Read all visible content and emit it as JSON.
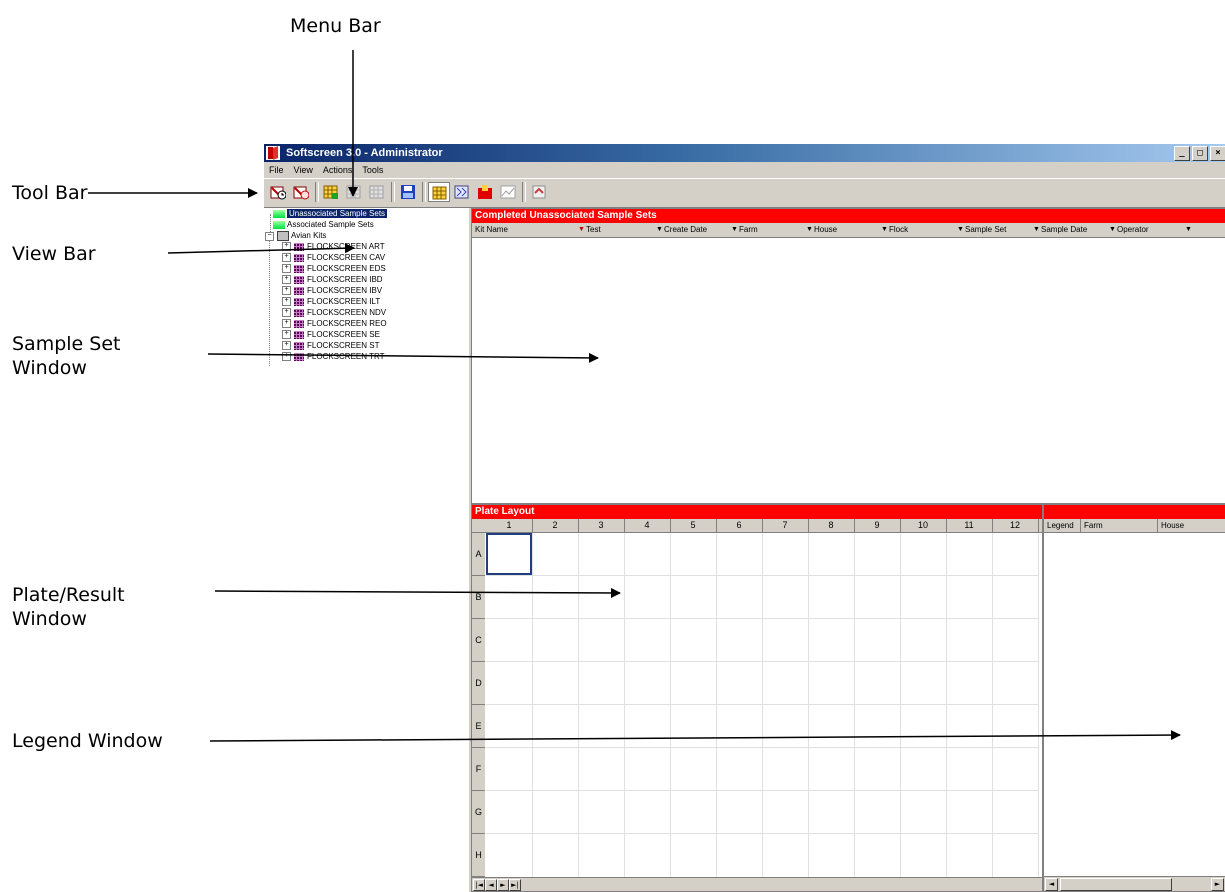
{
  "annotations": {
    "menu_bar": "Menu Bar",
    "tool_bar": "Tool Bar",
    "view_bar": "View Bar",
    "sample_set_window_line1": "Sample Set",
    "sample_set_window_line2": "Window",
    "plate_result_window_line1": "Plate/Result",
    "plate_result_window_line2": "Window",
    "legend_window": "Legend Window"
  },
  "window": {
    "title": "Softscreen 3.0 - Administrator",
    "title_buttons": [
      "_",
      "□",
      "×"
    ]
  },
  "menu": [
    "File",
    "View",
    "Actions",
    "Tools"
  ],
  "toolbar_icons": [
    "timer-sample-icon",
    "timer-result-icon",
    "plate-add-icon",
    "plate-disabled-icon",
    "plate-disabled-2-icon",
    "floppy-save-icon",
    "grid-view-icon",
    "pattern-view-icon",
    "red-chart-icon",
    "line-chart-icon",
    "exit-icon"
  ],
  "tree": {
    "unassociated": "Unassociated Sample Sets",
    "associated": "Associated Sample Sets",
    "avian_kits": "Avian Kits",
    "kits": [
      "FLOCKSCREEN ART",
      "FLOCKSCREEN CAV",
      "FLOCKSCREEN EDS",
      "FLOCKSCREEN IBD",
      "FLOCKSCREEN IBV",
      "FLOCKSCREEN ILT",
      "FLOCKSCREEN NDV",
      "FLOCKSCREEN REO",
      "FLOCKSCREEN SE",
      "FLOCKSCREEN ST",
      "FLOCKSCREEN TRT"
    ]
  },
  "sample_sets": {
    "header": "Completed Unassociated Sample Sets",
    "columns": [
      "Kit Name",
      "Test",
      "Create Date",
      "Farm",
      "House",
      "Flock",
      "Sample Set",
      "Sample Date",
      "Operator"
    ]
  },
  "plate": {
    "header": "Plate Layout",
    "columns": [
      "1",
      "2",
      "3",
      "4",
      "5",
      "6",
      "7",
      "8",
      "9",
      "10",
      "11",
      "12"
    ],
    "rows": [
      "A",
      "B",
      "C",
      "D",
      "E",
      "F",
      "G",
      "H"
    ],
    "nav": [
      "|◄",
      "◄",
      "►",
      "►|"
    ]
  },
  "legend": {
    "columns": [
      "Legend",
      "Farm",
      "House"
    ],
    "scroll_left": "◄",
    "scroll_right": "►"
  }
}
